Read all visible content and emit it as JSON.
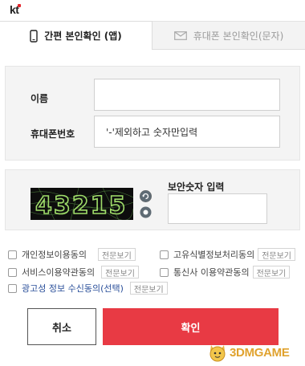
{
  "brand": {
    "logo_text": "kt"
  },
  "tabs": [
    {
      "label": "간편 본인확인 (앱)",
      "icon": "mobile-phone-icon",
      "active": true
    },
    {
      "label": "휴대폰 본인확인(문자)",
      "icon": "envelope-icon",
      "active": false
    }
  ],
  "form": {
    "name_label": "이름",
    "name_value": "",
    "phone_label": "휴대폰번호",
    "phone_placeholder": "'-'제외하고 숫자만입력"
  },
  "captcha": {
    "image_text": "43215",
    "input_label": "보안숫자 입력",
    "input_value": "",
    "refresh_icon": "refresh-icon",
    "audio_icon": "audio-icon"
  },
  "agreements": [
    {
      "label": "개인정보이용동의",
      "detail": "전문보기",
      "checked": false,
      "highlight": false
    },
    {
      "label": "고유식별정보처리동의",
      "detail": "전문보기",
      "checked": false,
      "highlight": false
    },
    {
      "label": "서비스이용약관동의",
      "detail": "전문보기",
      "checked": false,
      "highlight": false
    },
    {
      "label": "통신사 이용약관동의",
      "detail": "전문보기",
      "checked": false,
      "highlight": false
    },
    {
      "label": "광고성 정보 수신동의(선택)",
      "detail": "전문보기",
      "checked": false,
      "highlight": true
    }
  ],
  "buttons": {
    "cancel": "취소",
    "confirm": "확인"
  },
  "watermark": {
    "text": "3DMGAME"
  },
  "colors": {
    "accent": "#e83a44",
    "link": "#2a4f9a",
    "watermark": "#e0a22e"
  }
}
